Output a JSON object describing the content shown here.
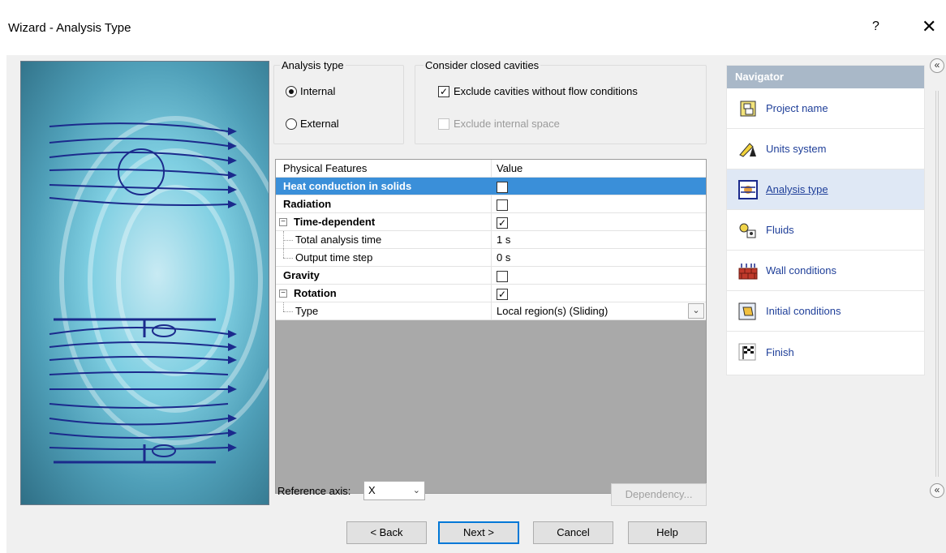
{
  "window": {
    "title": "Wizard - Analysis Type",
    "help_glyph": "?",
    "close_glyph": "✕"
  },
  "analysis_type": {
    "label": "Analysis type",
    "internal_label": "Internal",
    "external_label": "External",
    "selected": "Internal"
  },
  "cavities": {
    "label": "Consider closed cavities",
    "exclude_no_flow_label": "Exclude cavities without flow conditions",
    "exclude_no_flow_checked": true,
    "exclude_internal_label": "Exclude internal space",
    "exclude_internal_checked": false
  },
  "grid": {
    "col_feature": "Physical Features",
    "col_value": "Value",
    "rows": [
      {
        "name": "Heat conduction in solids",
        "value": "",
        "check": false
      },
      {
        "name": "Radiation",
        "value": "",
        "check": false
      },
      {
        "name": "Time-dependent",
        "value": "",
        "check": true
      },
      {
        "name": "Total analysis time",
        "value": "1 s"
      },
      {
        "name": "Output time step",
        "value": "0 s"
      },
      {
        "name": "Gravity",
        "value": "",
        "check": false
      },
      {
        "name": "Rotation",
        "value": "",
        "check": true
      },
      {
        "name": "Type",
        "value": "Local region(s) (Sliding)"
      }
    ],
    "check_mark": "✓",
    "expander_minus": "−",
    "dropdown_arrow": "⌄"
  },
  "reference_axis": {
    "label": "Reference axis:",
    "value": "X",
    "arrow": "⌄"
  },
  "buttons": {
    "dependency": "Dependency...",
    "back": "< Back",
    "next": "Next >",
    "cancel": "Cancel",
    "help": "Help"
  },
  "navigator": {
    "header": "Navigator",
    "items": [
      {
        "label": "Project name",
        "icon": "project-name-icon"
      },
      {
        "label": "Units system",
        "icon": "units-system-icon"
      },
      {
        "label": "Analysis type",
        "icon": "analysis-type-icon",
        "active": true
      },
      {
        "label": "Fluids",
        "icon": "fluids-icon"
      },
      {
        "label": "Wall conditions",
        "icon": "wall-conditions-icon"
      },
      {
        "label": "Initial conditions",
        "icon": "initial-conditions-icon"
      },
      {
        "label": "Finish",
        "icon": "finish-icon"
      }
    ],
    "collapse_glyph": "«"
  },
  "colors": {
    "selection": "#3a8fd9",
    "nav_header": "#a9b8c8",
    "nav_link": "#1f3f99"
  }
}
